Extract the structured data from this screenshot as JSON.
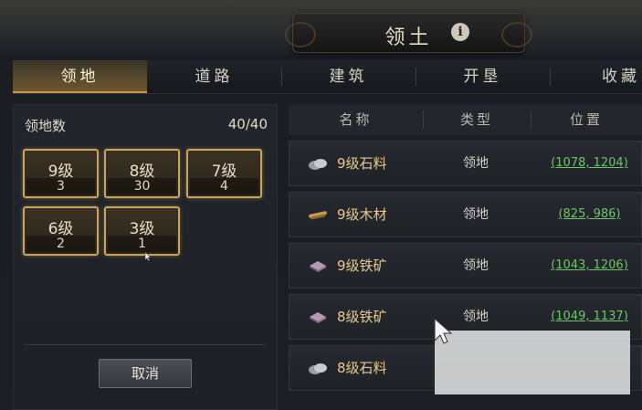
{
  "header": {
    "title": "领土",
    "info_glyph": "i"
  },
  "tabs": [
    {
      "label": "领地",
      "active": true
    },
    {
      "label": "道路",
      "active": false
    },
    {
      "label": "建筑",
      "active": false
    },
    {
      "label": "开垦",
      "active": false
    },
    {
      "label": "收藏",
      "active": false
    }
  ],
  "territory": {
    "count_label": "领地数",
    "count_value": "40/40",
    "levels": [
      {
        "level": "9级",
        "count": "3"
      },
      {
        "level": "8级",
        "count": "30"
      },
      {
        "level": "7级",
        "count": "4"
      },
      {
        "level": "6级",
        "count": "2"
      },
      {
        "level": "3级",
        "count": "1"
      }
    ],
    "cancel_label": "取消"
  },
  "table": {
    "headers": [
      "名称",
      "类型",
      "位置"
    ],
    "rows": [
      {
        "name": "9级石料",
        "type": "领地",
        "position": "(1078, 1204)",
        "icon": "stone-icon"
      },
      {
        "name": "9级木材",
        "type": "领地",
        "position": "(825, 986)",
        "icon": "wood-icon"
      },
      {
        "name": "9级铁矿",
        "type": "领地",
        "position": "(1043, 1206)",
        "icon": "iron-icon"
      },
      {
        "name": "8级铁矿",
        "type": "领地",
        "position": "(1049, 1137)",
        "icon": "iron-icon"
      },
      {
        "name": "8级石料",
        "type": "",
        "position": "",
        "icon": "stone-icon"
      }
    ]
  },
  "colors": {
    "accent_gold": "#c9a45a",
    "link_green": "#6fc36a",
    "name_gold": "#e6c98e"
  }
}
